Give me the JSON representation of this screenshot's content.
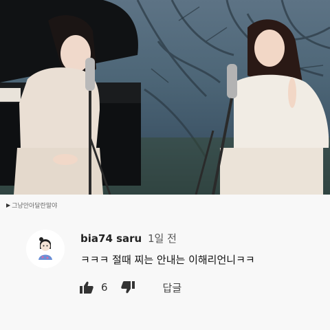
{
  "caption": {
    "play_glyph": "▶",
    "text": "그냥안아달란말야"
  },
  "comment": {
    "author": "bia74 saru",
    "time": "1일 전",
    "text": "ㅋㅋㅋ 절때 찌는 안내는 이해리언니ㅋㅋ",
    "likes": "6",
    "reply_label": "답글",
    "avatar_icon": "avatar-illustration",
    "like_icon": "thumbs-up-icon",
    "dislike_icon": "thumbs-down-icon"
  },
  "colors": {
    "background": "#f8f8f8",
    "text": "#222222",
    "video_tone": "#4d6677"
  }
}
